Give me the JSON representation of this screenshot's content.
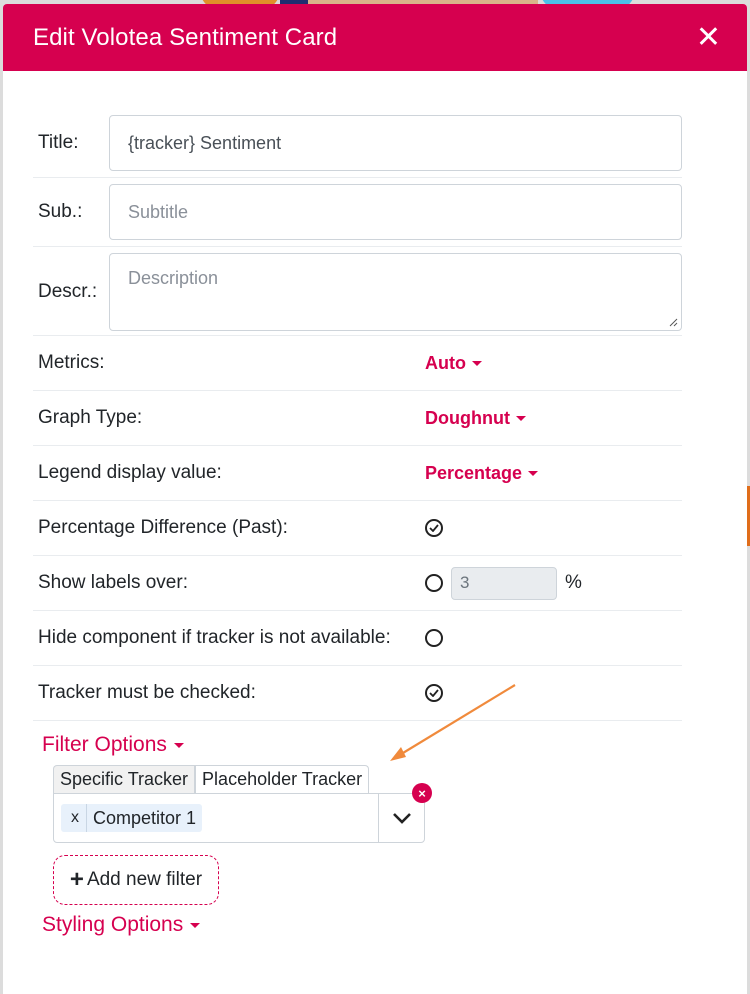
{
  "modal": {
    "title": "Edit Volotea Sentiment Card",
    "close_icon": "close-icon"
  },
  "fields": {
    "title_label": "Title:",
    "title_value": "{tracker} Sentiment",
    "sub_label": "Sub.:",
    "sub_placeholder": "Subtitle",
    "descr_label": "Descr.:",
    "descr_placeholder": "Description"
  },
  "options": {
    "metrics_label": "Metrics:",
    "metrics_value": "Auto",
    "graph_type_label": "Graph Type:",
    "graph_type_value": "Doughnut",
    "legend_label": "Legend display value:",
    "legend_value": "Percentage",
    "pct_diff_label": "Percentage Difference (Past):",
    "pct_diff_checked": true,
    "show_labels_label": "Show labels over:",
    "show_labels_checked": false,
    "show_labels_value": "3",
    "show_labels_unit": "%",
    "hide_component_label": "Hide component if tracker is not available:",
    "hide_component_checked": false,
    "tracker_checked_label": "Tracker must be checked:",
    "tracker_checked_checked": true
  },
  "filter": {
    "section_label": "Filter Options",
    "tabs": [
      "Specific Tracker",
      "Placeholder Tracker"
    ],
    "chip_remove": "x",
    "selected": "Competitor 1",
    "clear_badge": "×",
    "add_label": "Add new filter"
  },
  "styling": {
    "section_label": "Styling Options"
  },
  "colors": {
    "accent": "#d6004f",
    "annotation_arrow": "#f08a3c"
  }
}
